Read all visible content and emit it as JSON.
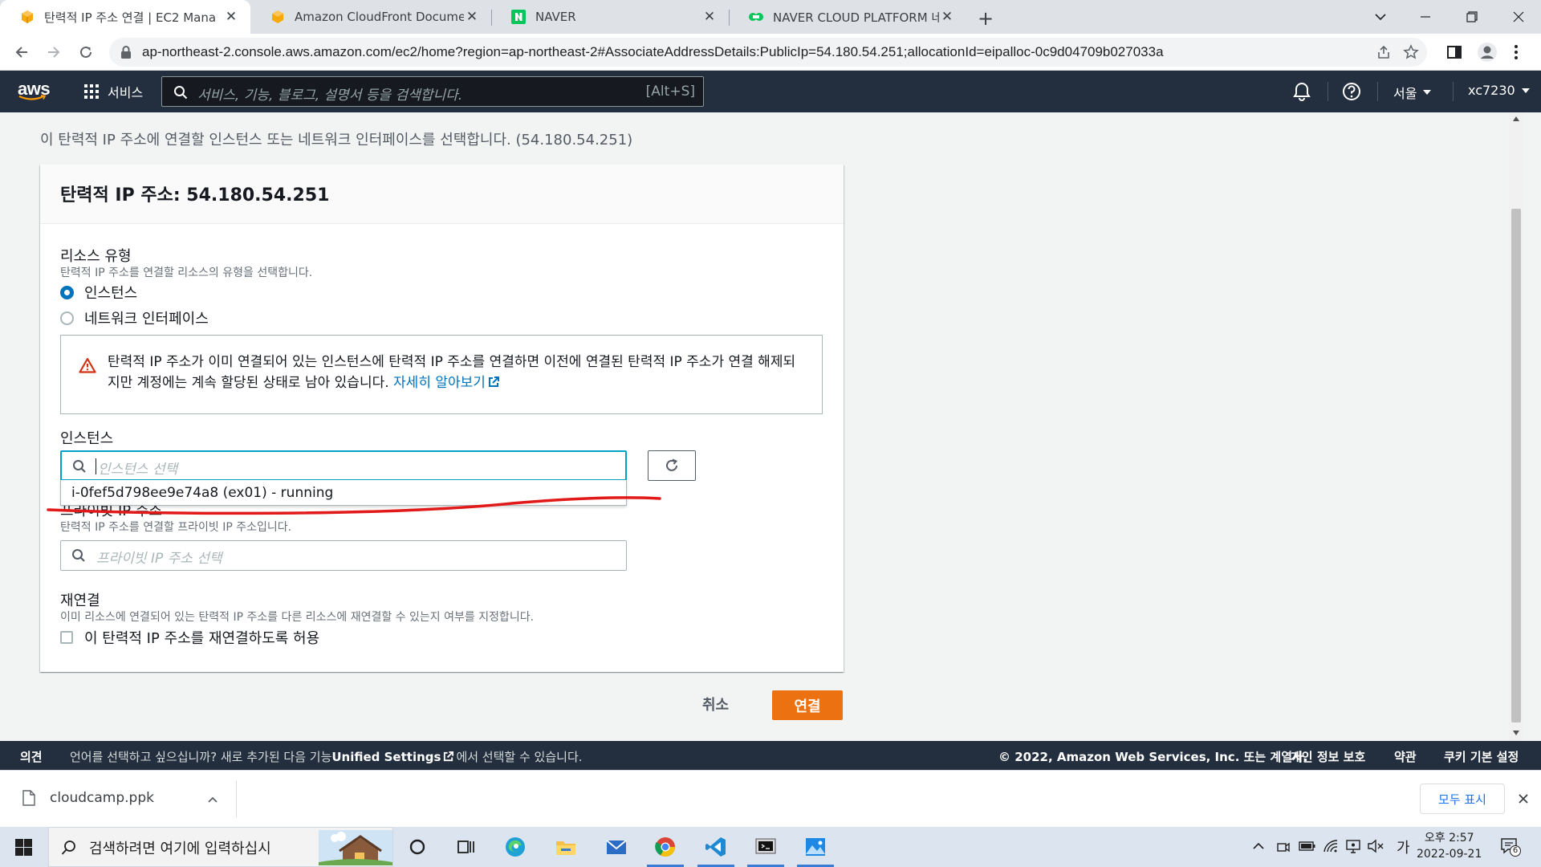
{
  "browser": {
    "tabs": [
      {
        "title": "탄력적 IP 주소 연결 | EC2 Mana",
        "active": true
      },
      {
        "title": "Amazon CloudFront Documenta",
        "active": false
      },
      {
        "title": "NAVER",
        "active": false
      },
      {
        "title": "NAVER CLOUD PLATFORM 네이",
        "active": false
      }
    ],
    "url": "ap-northeast-2.console.aws.amazon.com/ec2/home?region=ap-northeast-2#AssociateAddressDetails:PublicIp=54.180.54.251;allocationId=eipalloc-0c9d04709b027033a"
  },
  "aws_header": {
    "logo": "aws",
    "services_label": "서비스",
    "search_placeholder": "서비스, 기능, 블로그, 설명서 등을 검색합니다.",
    "search_shortcut": "[Alt+S]",
    "region": "서울",
    "account": "xc7230"
  },
  "page": {
    "subtitle": "이 탄력적 IP 주소에 연결할 인스턴스 또는 네트워크 인터페이스를 선택합니다. (54.180.54.251)",
    "panel_title": "탄력적 IP 주소: 54.180.54.251",
    "resource_type": {
      "label": "리소스 유형",
      "description": "탄력적 IP 주소를 연결할 리소스의 유형을 선택합니다.",
      "options": [
        {
          "label": "인스턴스",
          "selected": true
        },
        {
          "label": "네트워크 인터페이스",
          "selected": false
        }
      ]
    },
    "warning": {
      "text": "탄력적 IP 주소가 이미 연결되어 있는 인스턴스에 탄력적 IP 주소를 연결하면 이전에 연결된 탄력적 IP 주소가 연결 해제되지만 계정에는 계속 할당된 상태로 남아 있습니다.",
      "link": "자세히 알아보기"
    },
    "instance": {
      "label": "인스턴스",
      "placeholder": "인스턴스 선택",
      "dropdown_option": "i-0fef5d798ee9e74a8 (ex01) - running"
    },
    "private_ip": {
      "label": "프라이빗 IP 주소",
      "description": "탄력적 IP 주소를 연결할 프라이빗 IP 주소입니다.",
      "placeholder": "프라이빗 IP 주소 선택"
    },
    "reassociation": {
      "label": "재연결",
      "description": "이미 리소스에 연결되어 있는 탄력적 IP 주소를 다른 리소스에 재연결할 수 있는지 여부를 지정합니다.",
      "checkbox_label": "이 탄력적 IP 주소를 재연결하도록 허용",
      "checked": false
    },
    "cancel_label": "취소",
    "connect_label": "연결"
  },
  "aws_footer": {
    "feedback": "의견",
    "language_prompt_pre": "언어를 선택하고 싶으십니까? 새로 추가된 다음 기능",
    "language_link": "Unified Settings",
    "language_prompt_post": "에서 선택할 수 있습니다.",
    "copyright": "© 2022, Amazon Web Services, Inc. 또는 계열사.",
    "privacy": "개인 정보 보호",
    "terms": "약관",
    "cookie": "쿠키 기본 설정"
  },
  "download_bar": {
    "filename": "cloudcamp.ppk",
    "show_all": "모두 표시"
  },
  "taskbar": {
    "search_placeholder": "검색하려면 여기에 입력하십시",
    "ime": "가",
    "time": "오후 2:57",
    "date": "2022-09-21",
    "notification_count": "6"
  },
  "colors": {
    "aws_nav": "#232f3e",
    "primary_button": "#ec7211",
    "link": "#0073bb",
    "focus": "#00a1c9",
    "annotation": "#e11919"
  }
}
